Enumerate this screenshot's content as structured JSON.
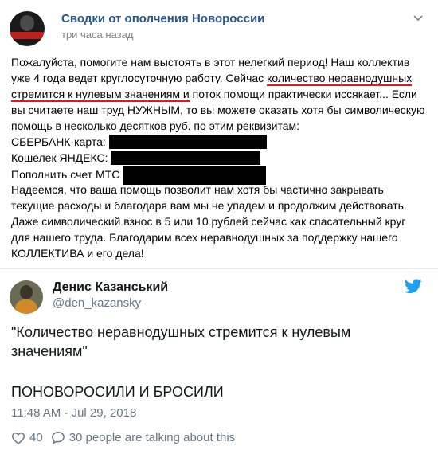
{
  "vk_post": {
    "group_name": "Сводки от ополчения Новороссии",
    "time": "три часа назад",
    "more_icon": "chevron-down-icon",
    "lines": {
      "l1": "Пожалуйста, помогите нам выстоять в этот нелегкий период! Наш коллектив",
      "l2a": "уже 4 года ведет круглосуточную работу. Сейчас ",
      "l2b": "количество неравнодушных",
      "l3a": "стремится к нулевым значениям и",
      "l3b": " поток помощи практически иссякает... Если",
      "l4": "вы считаете наш труд НУЖНЫМ, то вы можете оказать хотя бы символическую",
      "l5": "помощь в несколько десятков руб. по этим реквизитам:",
      "l6": "СБЕРБАНК-карта:",
      "l7": "Кошелек ЯНДЕКС:",
      "l8": "Пополнить счет МТС",
      "l9": "Надеемся, что ваша помощь позволит нам хотя бы частично закрывать",
      "l10": "текущие расходы и благодаря вам мы не упадем и продолжим действовать.",
      "l11": "Даже символический взнос в 5 или 10 рублей сейчас как спасательный круг",
      "l12": "для нашего труда. Благодарим всех неравнодушных за поддержку нашего",
      "l13": "КОЛЛЕКТИВА и его дела!"
    },
    "highlight_color": "#e8141b"
  },
  "tweet": {
    "name": "Денис Казанський",
    "handle": "@den_kazansky",
    "quote": "\"Количество неравнодушных стремится к нулевым значениям\"",
    "text": "ПОНОВОРОСИЛИ И БРОСИЛИ",
    "date": "11:48 AM - Jul 29, 2018",
    "likes": "40",
    "talking": "30 people are talking about this",
    "brand_color": "#1da1f2"
  }
}
